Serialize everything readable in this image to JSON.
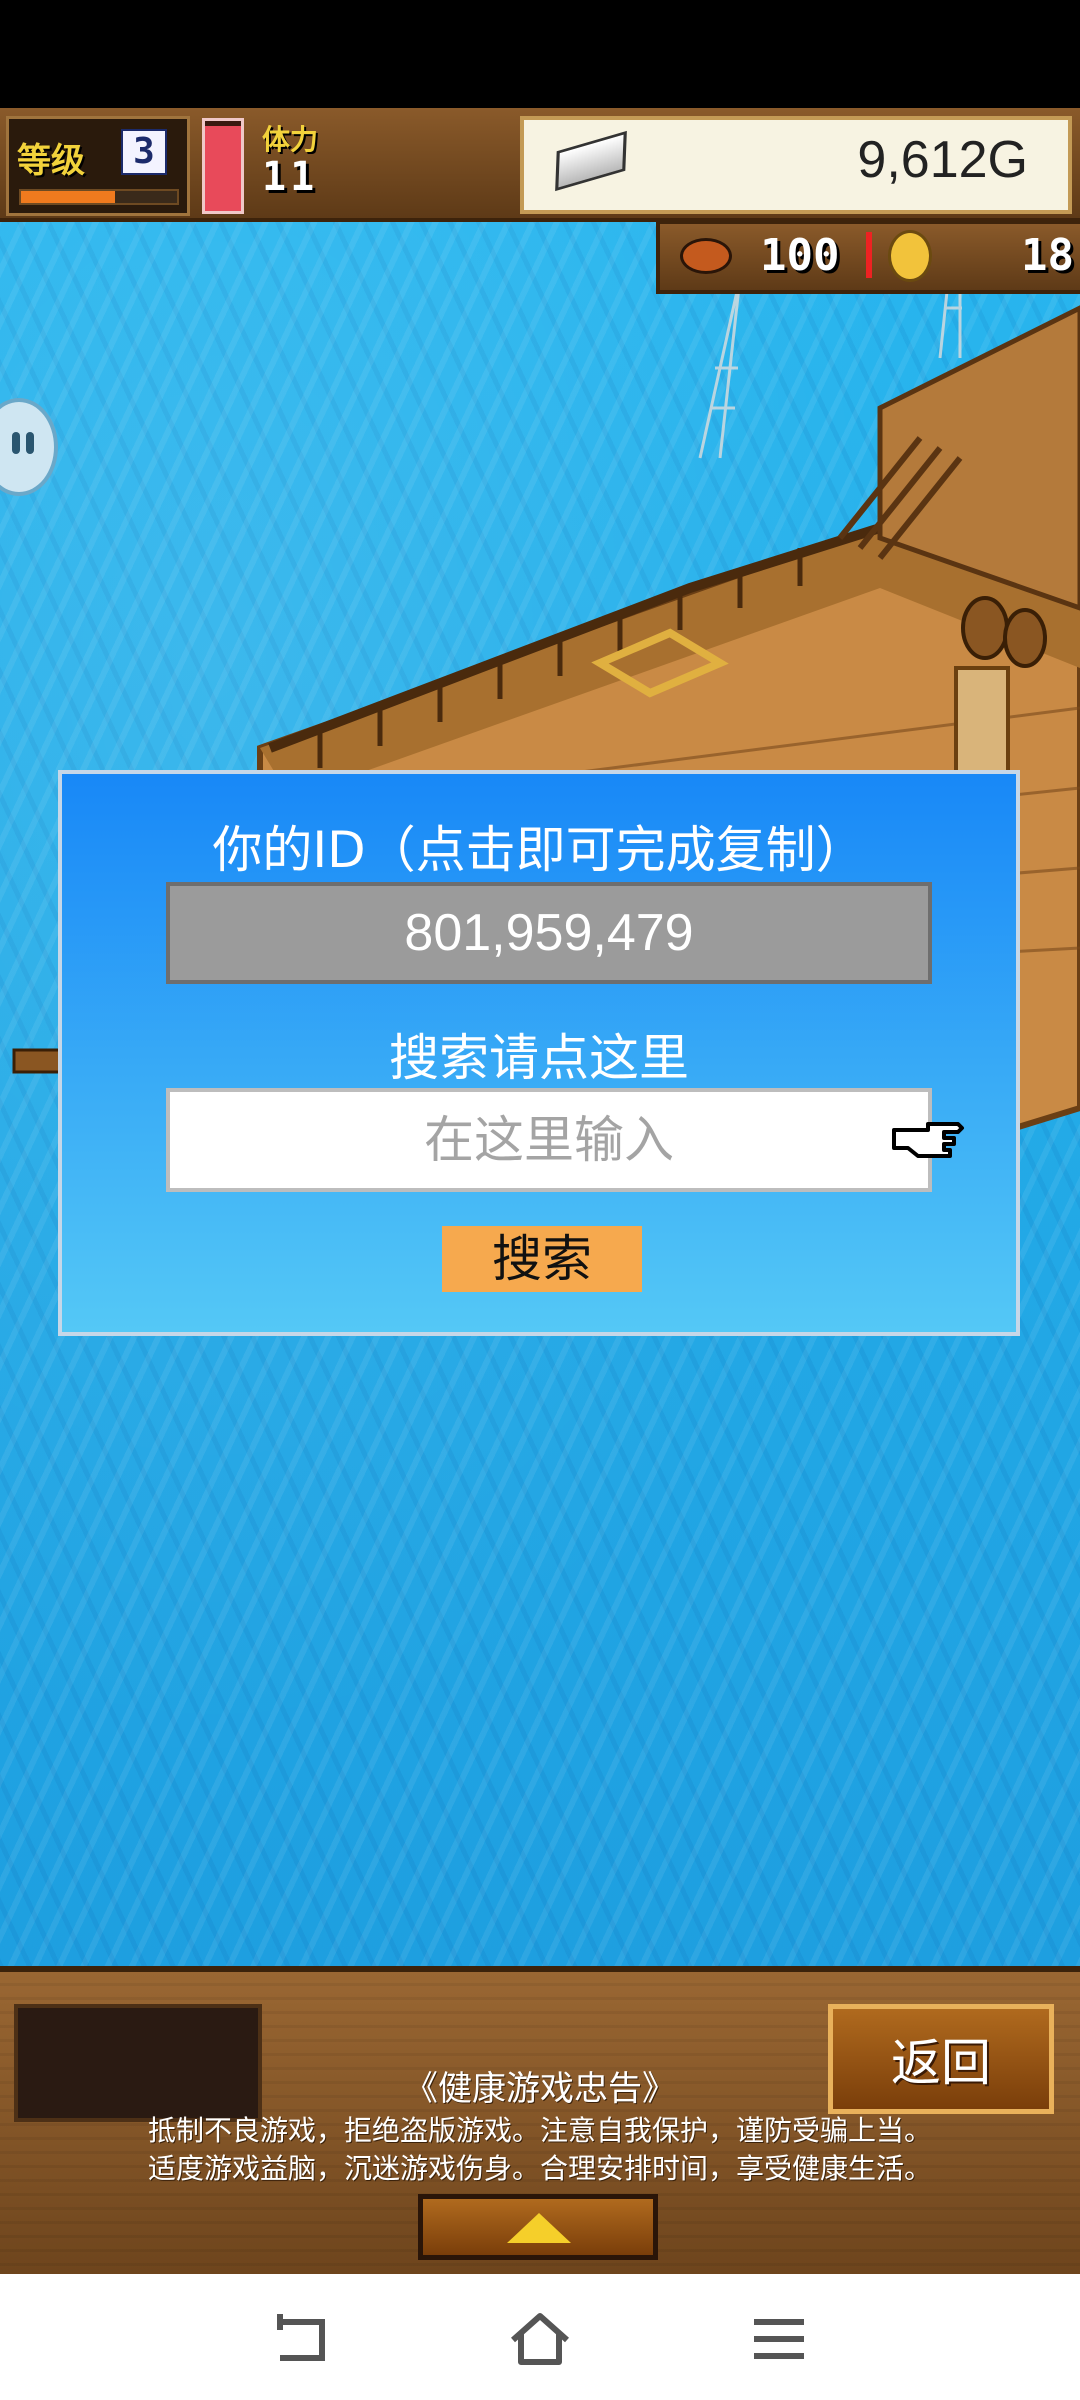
{
  "hud": {
    "level_label": "等级",
    "level_value": "3",
    "xp_fraction": 0.6,
    "stamina_label": "体力",
    "stamina_value": "11",
    "stamina_fraction": 0.95,
    "gold_value": "9,612G",
    "food_value": "100",
    "medal_value": "18"
  },
  "dialog": {
    "title": "你的ID（点击即可完成复制）",
    "user_id": "801,959,479",
    "search_hint": "搜索请点这里",
    "search_placeholder": "在这里输入",
    "search_button": "搜索"
  },
  "bottom": {
    "return_button": "返回",
    "advisory_title": "《健康游戏忠告》",
    "advisory_line1": "抵制不良游戏，拒绝盗版游戏。注意自我保护，谨防受骗上当。",
    "advisory_line2": "适度游戏益脑，沉迷游戏伤身。合理安排时间，享受健康生活。"
  },
  "icons": {
    "back": "back-icon",
    "home": "home-icon",
    "menu": "menu-icon",
    "pointing_hand": "pointing-hand-icon",
    "expand": "triangle-up-icon"
  },
  "colors": {
    "dialog_top": "#1888f7",
    "dialog_bottom": "#54c8f6",
    "search_button": "#f6a94e",
    "id_field": "#9b9b9b",
    "sea": "#1aa6e6"
  }
}
